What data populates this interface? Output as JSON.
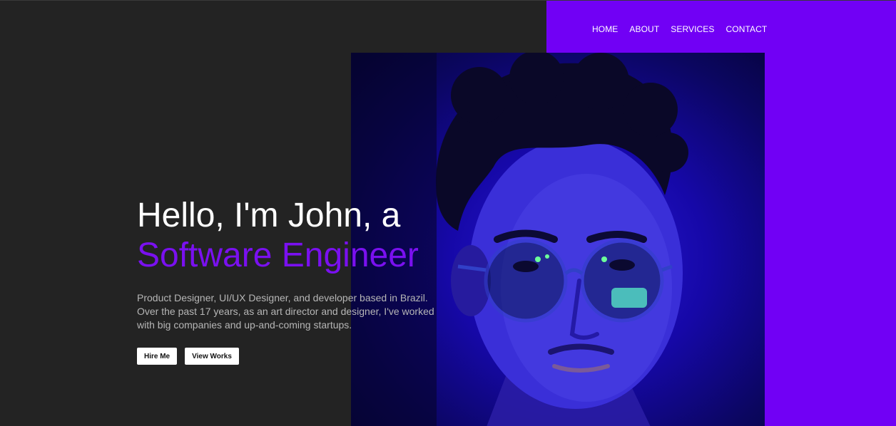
{
  "nav": {
    "items": [
      {
        "label": "HOME"
      },
      {
        "label": "ABOUT"
      },
      {
        "label": "SERVICES"
      },
      {
        "label": "CONTACT"
      }
    ]
  },
  "hero": {
    "greeting": "Hello, I'm John, a",
    "role": "Software Engineer",
    "description": "Product Designer, UI/UX Designer, and developer based in Brazil. Over the past 17 years, as an art director and designer, I've worked with big companies and up-and-coming startups.",
    "hire_label": "Hire Me",
    "works_label": "View Works"
  },
  "colors": {
    "background": "#232323",
    "accent": "#7100f5",
    "role_text": "#7a10f0"
  }
}
